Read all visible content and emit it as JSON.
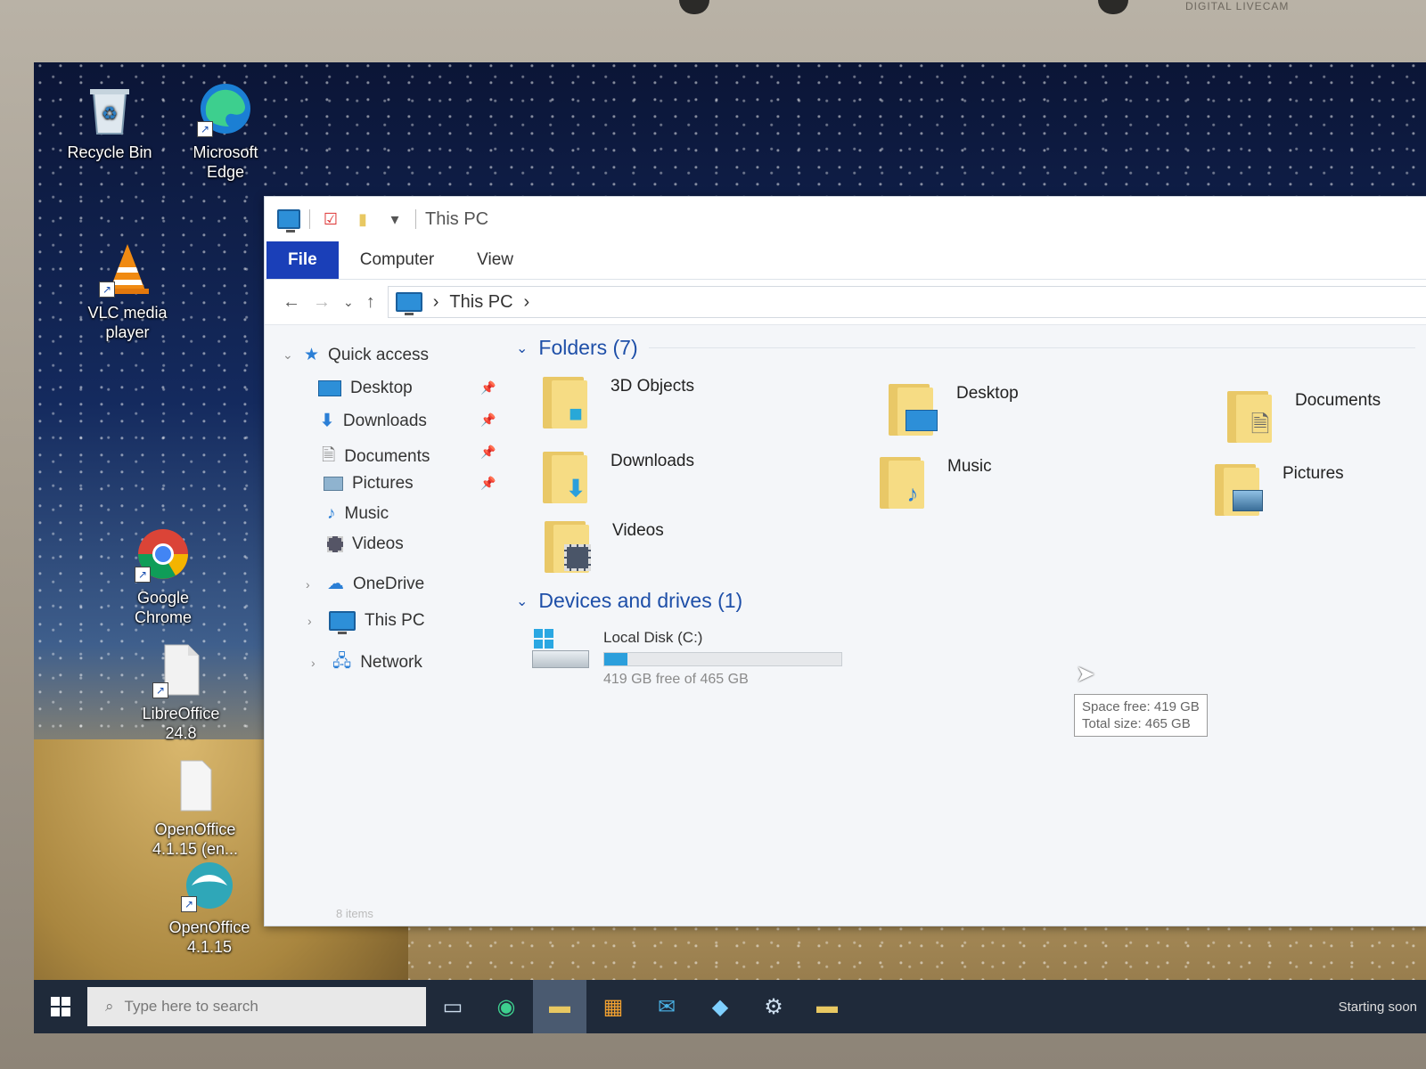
{
  "bezel": {
    "webcam_label": "DIGITAL LIVECAM"
  },
  "desktop": {
    "icons": [
      {
        "label": "Recycle Bin",
        "icon": "recycle-bin-icon"
      },
      {
        "label": "Microsoft Edge",
        "icon": "edge-icon"
      },
      {
        "label": "VLC media player",
        "icon": "vlc-icon"
      },
      {
        "label": "Google Chrome",
        "icon": "chrome-icon"
      },
      {
        "label": "LibreOffice 24.8",
        "icon": "libreoffice-icon"
      },
      {
        "label": "OpenOffice 4.1.15 (en...",
        "icon": "openoffice-installer-icon"
      },
      {
        "label": "OpenOffice 4.1.15",
        "icon": "openoffice-icon"
      }
    ]
  },
  "explorer": {
    "title": "This PC",
    "ribbon_tabs": [
      "File",
      "Computer",
      "View"
    ],
    "address": {
      "location": "This PC"
    },
    "nav": {
      "quick_access": "Quick access",
      "pinned": [
        {
          "label": "Desktop",
          "icon": "desktop-icon"
        },
        {
          "label": "Downloads",
          "icon": "download-arrow-icon"
        },
        {
          "label": "Documents",
          "icon": "document-icon"
        },
        {
          "label": "Pictures",
          "icon": "picture-icon"
        }
      ],
      "unpinned": [
        {
          "label": "Music",
          "icon": "music-note-icon"
        },
        {
          "label": "Videos",
          "icon": "film-icon"
        }
      ],
      "roots": [
        {
          "label": "OneDrive",
          "icon": "cloud-icon"
        },
        {
          "label": "This PC",
          "icon": "computer-icon"
        },
        {
          "label": "Network",
          "icon": "network-icon"
        }
      ]
    },
    "folders_header": "Folders (7)",
    "folders": [
      {
        "label": "3D Objects",
        "icon": "cube-icon"
      },
      {
        "label": "Desktop",
        "icon": "desktop-icon"
      },
      {
        "label": "Documents",
        "icon": "document-icon"
      },
      {
        "label": "Downloads",
        "icon": "download-arrow-icon"
      },
      {
        "label": "Music",
        "icon": "music-note-icon"
      },
      {
        "label": "Pictures",
        "icon": "picture-icon"
      },
      {
        "label": "Videos",
        "icon": "film-icon"
      }
    ],
    "devices_header": "Devices and drives (1)",
    "drive": {
      "name": "Local Disk (C:)",
      "free_text": "419 GB free of 465 GB",
      "used_fraction": 0.099,
      "bar_color": "#2b9fdc"
    },
    "tooltip": {
      "line1": "Space free: 419 GB",
      "line2": "Total size: 465 GB"
    },
    "status": "8 items"
  },
  "taskbar": {
    "search_placeholder": "Type here to search",
    "status_text": "Starting soon"
  },
  "colors": {
    "file_tab": "#1a3fb8",
    "group_header": "#1e4fa8",
    "taskbar": "#1f2a3a"
  }
}
